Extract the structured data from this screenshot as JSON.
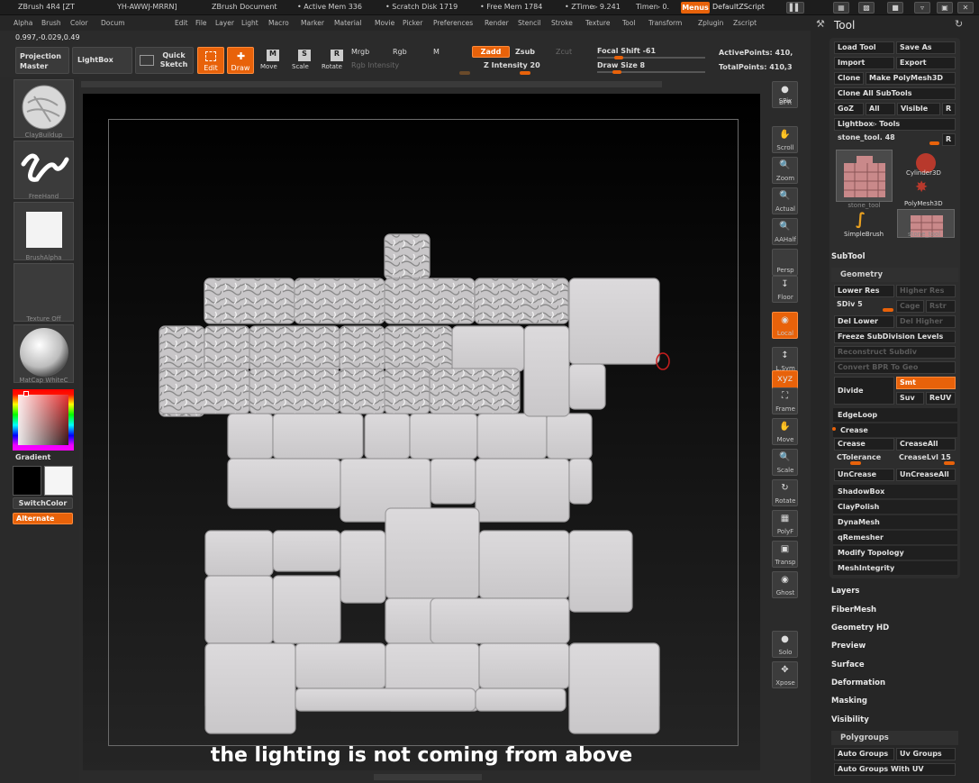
{
  "titlebar": {
    "app": "ZBrush 4R4 [ZT",
    "app_tail": "YH-AWWJ-MRRN]",
    "document": "ZBrush Document",
    "active_mem": "• Active Mem 336",
    "scratch": "• Scratch Disk 1719",
    "free_mem": "• Free Mem 1784",
    "ztime": "• ZTime▹ 9.241",
    "timer": "Timer▹ 0.",
    "menus_label": "Menus",
    "default_zscript": "DefaultZScript"
  },
  "menubar": [
    "Alpha",
    "Brush",
    "Color",
    "Docum",
    "Edit",
    "File",
    "Layer",
    "Light",
    "Macro",
    "Marker",
    "Material",
    "Movie",
    "Picker",
    "Preferences",
    "Render",
    "Stencil",
    "Stroke",
    "Texture",
    "Tool",
    "Transform",
    "Zplugin",
    "Zscript"
  ],
  "coords": "0.997,-0.029,0.49",
  "toolbar": {
    "projection_master": "Projection Master",
    "lightbox": "LightBox",
    "quick_sketch": "Quick Sketch",
    "edit": "Edit",
    "draw": "Draw",
    "move": "Move",
    "scale": "Scale",
    "rotate": "Rotate",
    "mrgb": "Mrgb",
    "rgb": "Rgb",
    "m": "M",
    "rgb_intensity": "Rgb Intensity",
    "zadd": "Zadd",
    "zsub": "Zsub",
    "zcut": "Zcut",
    "z_intensity": "Z Intensity 20",
    "focal_shift": "Focal Shift -61",
    "draw_size": "Draw Size 8",
    "active_points": "ActivePoints: 410,",
    "total_points": "TotalPoints: 410,3"
  },
  "left_shelf": {
    "brush": "ClayBuildup",
    "stroke": "FreeHand",
    "alpha": "BrushAlpha",
    "texture": "Texture Off",
    "material": "MatCap WhiteC",
    "gradient": "Gradient",
    "switchcolor": "SwitchColor",
    "alternate": "Alternate"
  },
  "right_shelf": [
    "BPR",
    "SPix",
    "Scroll",
    "Zoom",
    "Actual",
    "AAHalf",
    "Persp",
    "Floor",
    "Local",
    "L.Sym",
    "XYZ",
    "Frame",
    "Move",
    "Scale",
    "Rotate",
    "PolyF",
    "Transp",
    "Ghost",
    "Solo",
    "Xpose"
  ],
  "canvas": {
    "caption": "the lighting is not coming from above"
  },
  "tool_palette": {
    "title": "Tool",
    "load_tool": "Load Tool",
    "save_as": "Save As",
    "import": "Import",
    "export": "Export",
    "clone": "Clone",
    "make_polymesh": "Make PolyMesh3D",
    "clone_all": "Clone All SubTools",
    "goz": "GoZ",
    "all": "All",
    "visible": "Visible",
    "r": "R",
    "lightbox_tools": "Lightbox▹ Tools",
    "current_tool": "stone_tool. 48",
    "tools": [
      "stone_tool",
      "Cylinder3D",
      "PolyMesh3D",
      "SimpleBrush",
      "stone_tool"
    ],
    "subtool": "SubTool",
    "geometry": "Geometry",
    "lower_res": "Lower Res",
    "higher_res": "Higher Res",
    "sdiv": "SDiv 5",
    "cage": "Cage",
    "rstr": "Rstr",
    "del_lower": "Del Lower",
    "del_higher": "Del Higher",
    "freeze_subdiv": "Freeze SubDivision Levels",
    "reconstruct": "Reconstruct Subdiv",
    "convert_bpr": "Convert BPR To Geo",
    "divide": "Divide",
    "smt": "Smt",
    "suv": "Suv",
    "reuv": "ReUV",
    "edgeloop": "EdgeLoop",
    "crease_head": "Crease",
    "crease": "Crease",
    "crease_all": "CreaseAll",
    "ctolerance": "CTolerance",
    "crease_lvl": "CreaseLvl 15",
    "uncrease": "UnCrease",
    "uncrease_all": "UnCreaseAll",
    "shadowbox": "ShadowBox",
    "claypolish": "ClayPolish",
    "dynamesh": "DynaMesh",
    "qremesher": "qRemesher",
    "modify_topology": "Modify Topology",
    "meshintegrity": "MeshIntegrity",
    "layers": "Layers",
    "fibermesh": "FiberMesh",
    "geometry_hd": "Geometry HD",
    "preview": "Preview",
    "surface": "Surface",
    "deformation": "Deformation",
    "masking": "Masking",
    "visibility": "Visibility",
    "polygroups": "Polygroups",
    "auto_groups": "Auto Groups",
    "uv_groups": "Uv Groups",
    "auto_groups_uv": "Auto Groups With UV"
  },
  "colors": {
    "accent": "#e8620a",
    "stone": "#d2d0d2",
    "bg": "#2b2b2b"
  }
}
